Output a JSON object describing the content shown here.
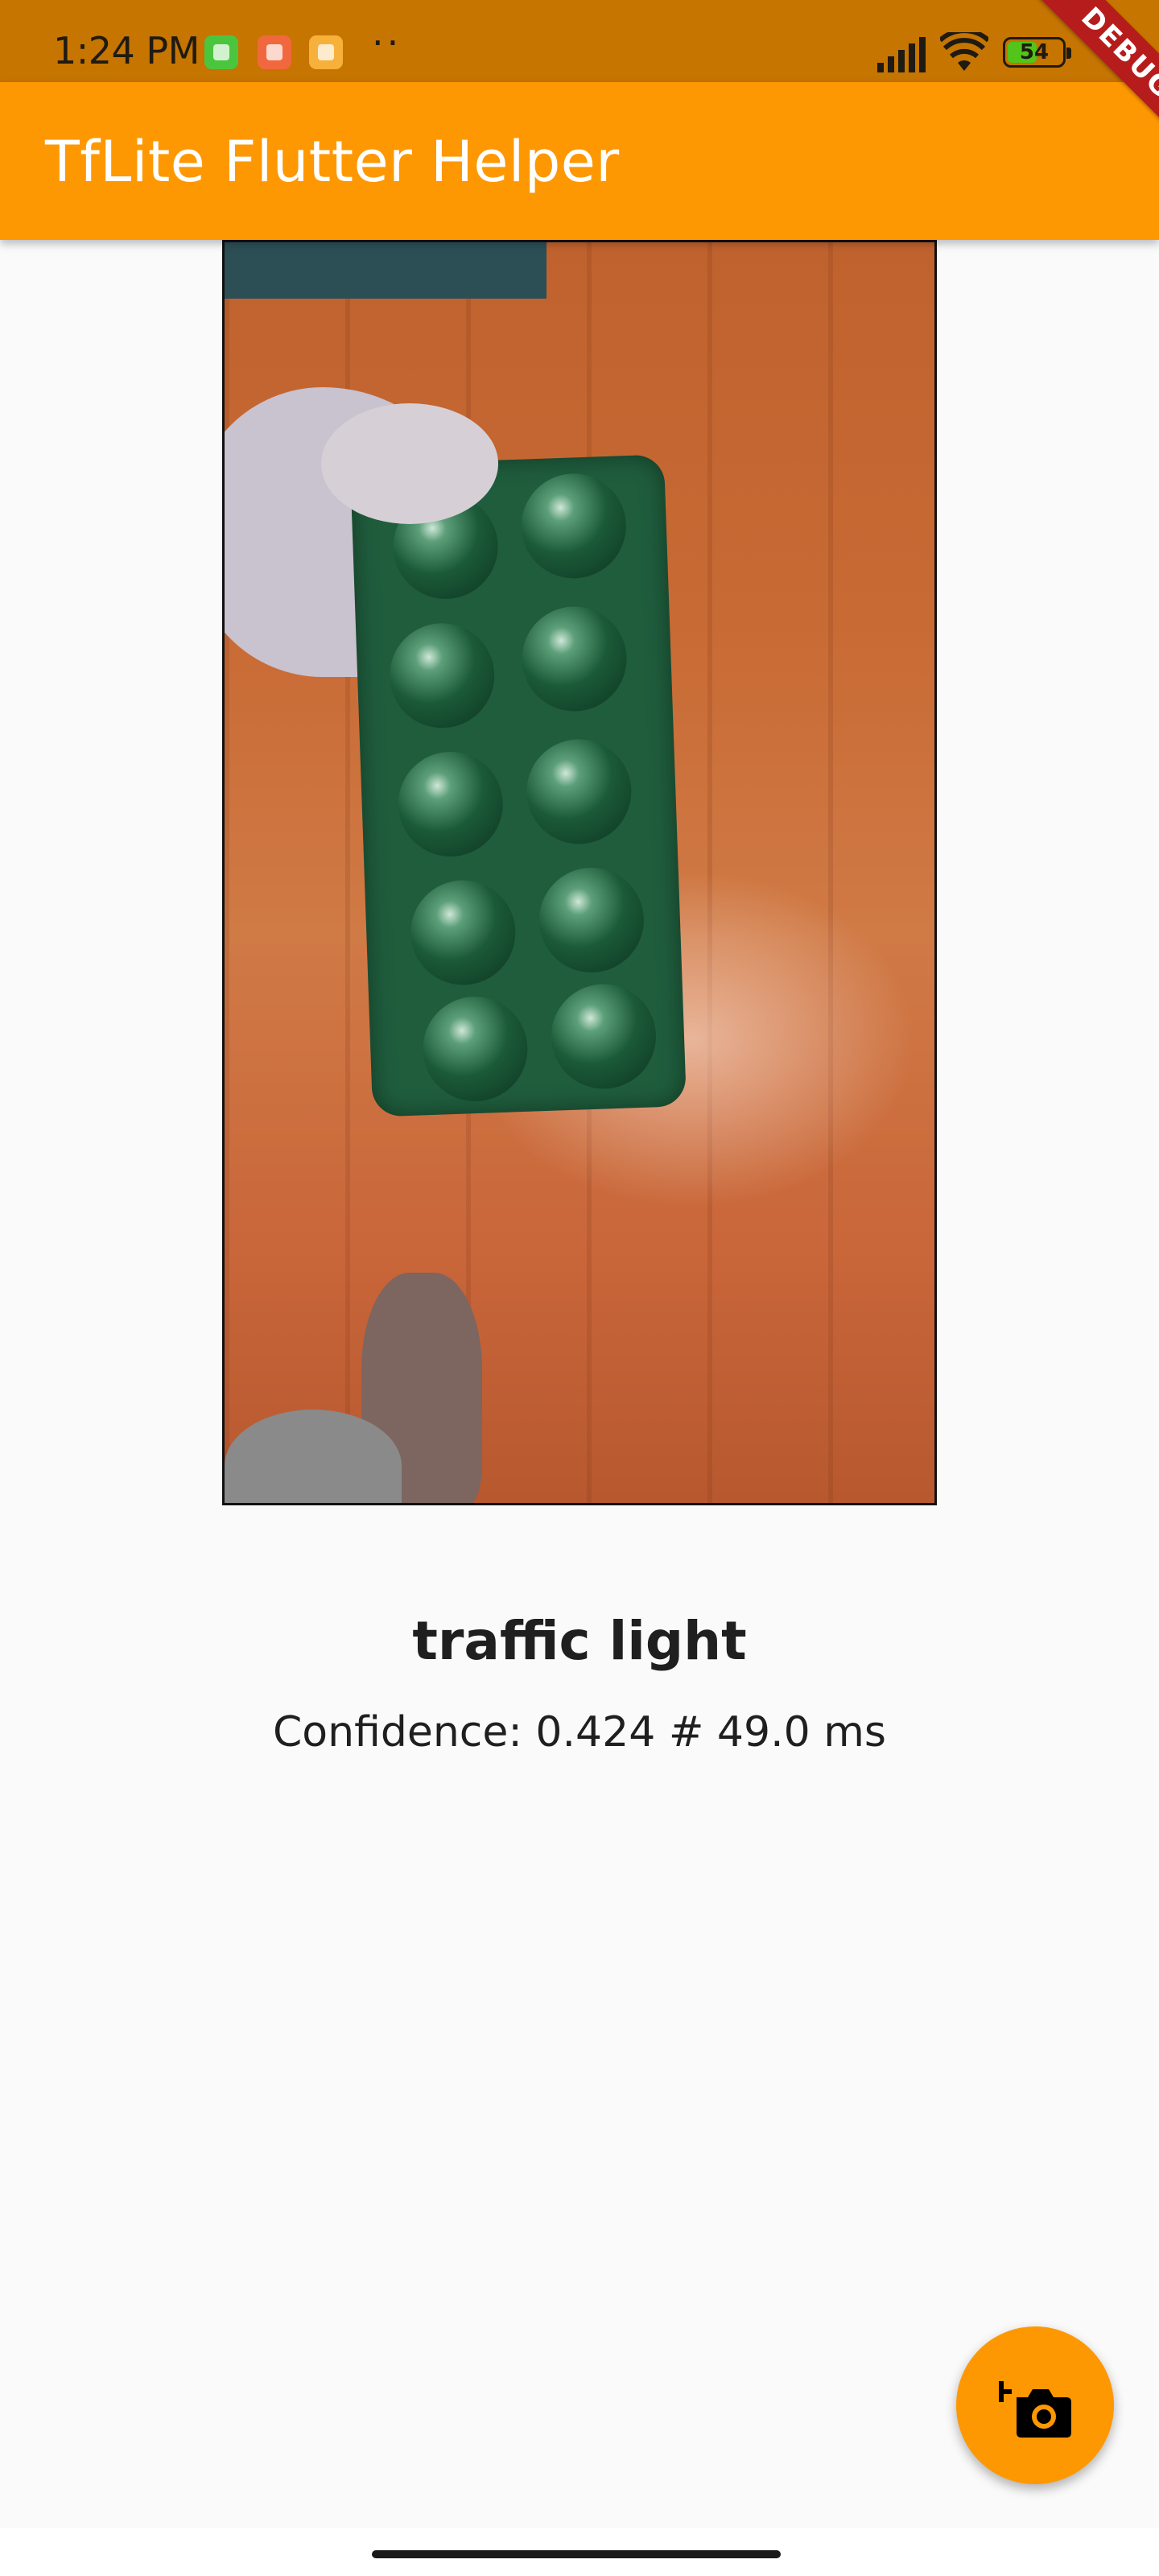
{
  "status_bar": {
    "time": "1:24 PM",
    "more": "··",
    "battery": "54",
    "battery_level_percent": 54,
    "icons": [
      "notification-app-icon",
      "notification-app-icon",
      "notification-app-icon",
      "signal-icon",
      "wifi-icon",
      "battery-icon"
    ]
  },
  "app_bar": {
    "title": "TfLite Flutter Helper",
    "color": "#fe9802"
  },
  "debug_banner": "DEBUG",
  "result": {
    "label": "traffic light",
    "detail": "Confidence: 0.424 # 49.0 ms"
  },
  "fab": {
    "icon": "add-a-photo-icon",
    "color": "#fe9802"
  }
}
